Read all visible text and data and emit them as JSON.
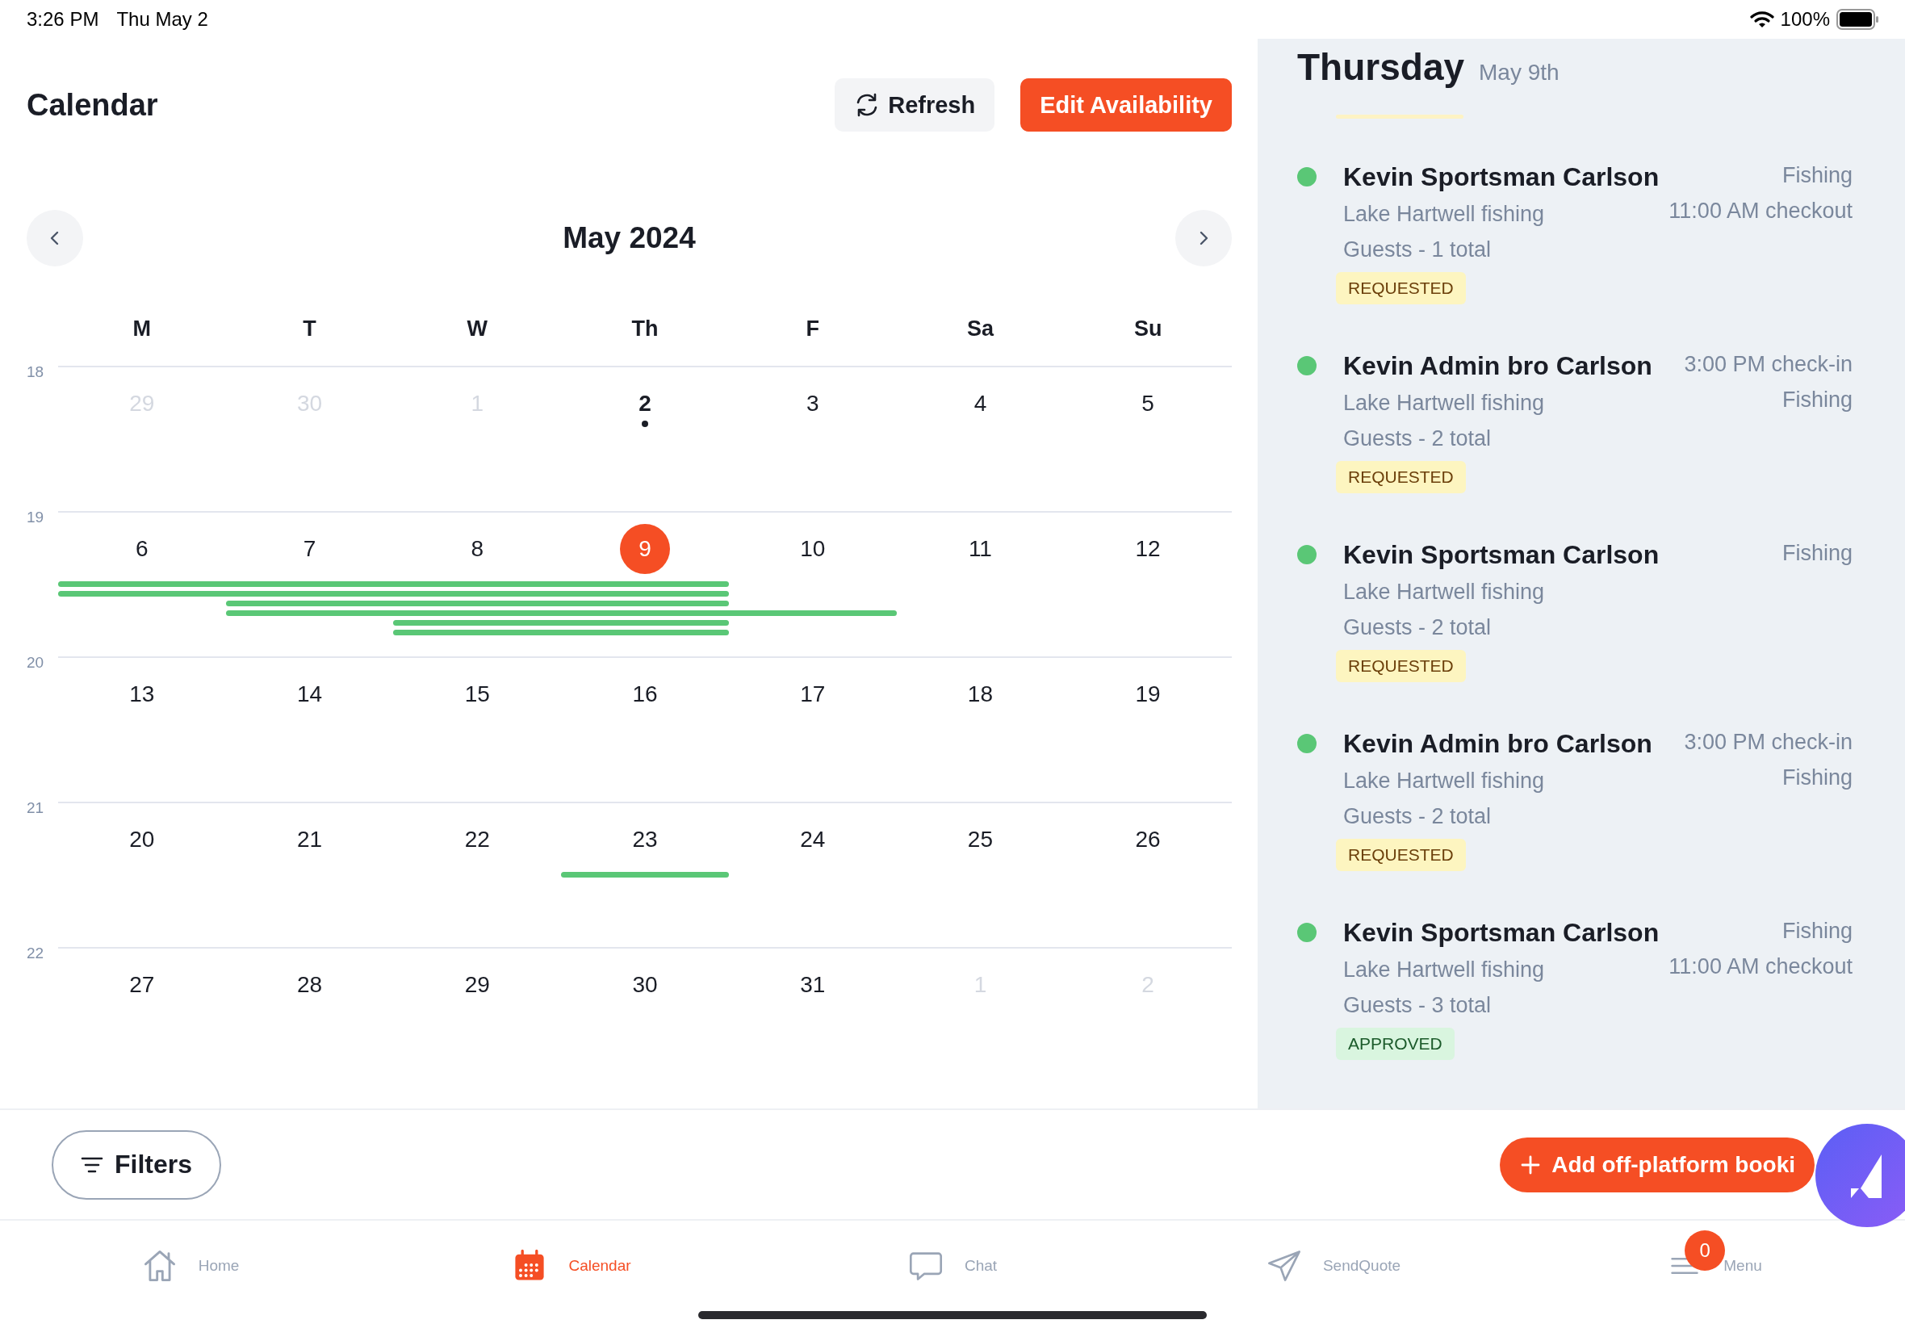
{
  "status_bar": {
    "time": "3:26 PM",
    "date": "Thu May 2",
    "battery": "100%"
  },
  "header": {
    "title": "Calendar",
    "buttons": [
      {
        "label": "Refresh",
        "kind": "secondary"
      },
      {
        "label": "Edit Availability",
        "kind": "primary"
      }
    ]
  },
  "calendar": {
    "month": "May 2024",
    "weekdays": [
      "M",
      "T",
      "W",
      "Th",
      "F",
      "Sa",
      "Su"
    ],
    "weeks": [
      {
        "number": "18",
        "days": [
          {
            "label": "29",
            "muted": true,
            "today": false,
            "selected": false
          },
          {
            "label": "30",
            "muted": true,
            "today": false,
            "selected": false
          },
          {
            "label": "1",
            "muted": true,
            "today": false,
            "selected": false
          },
          {
            "label": "2",
            "muted": false,
            "today": true,
            "selected": false
          },
          {
            "label": "3",
            "muted": false,
            "today": false,
            "selected": false
          },
          {
            "label": "4",
            "muted": false,
            "today": false,
            "selected": false
          },
          {
            "label": "5",
            "muted": false,
            "today": false,
            "selected": false
          }
        ]
      },
      {
        "number": "19",
        "days": [
          {
            "label": "6",
            "muted": false,
            "today": false,
            "selected": false
          },
          {
            "label": "7",
            "muted": false,
            "today": false,
            "selected": false
          },
          {
            "label": "8",
            "muted": false,
            "today": false,
            "selected": false
          },
          {
            "label": "9",
            "muted": false,
            "today": false,
            "selected": true
          },
          {
            "label": "10",
            "muted": false,
            "today": false,
            "selected": false
          },
          {
            "label": "11",
            "muted": false,
            "today": false,
            "selected": false
          },
          {
            "label": "12",
            "muted": false,
            "today": false,
            "selected": false
          }
        ],
        "bars": [
          {
            "days": [
              true,
              true,
              true,
              true,
              false,
              false,
              false
            ]
          },
          {
            "days": [
              true,
              true,
              true,
              true,
              false,
              false,
              false
            ]
          },
          {
            "days": [
              false,
              true,
              true,
              true,
              false,
              false,
              false
            ]
          },
          {
            "days": [
              false,
              true,
              true,
              true,
              true,
              false,
              false
            ]
          },
          {
            "days": [
              false,
              false,
              true,
              true,
              false,
              false,
              false
            ]
          },
          {
            "days": [
              false,
              false,
              true,
              true,
              false,
              false,
              false
            ]
          }
        ]
      },
      {
        "number": "20",
        "days": [
          {
            "label": "13",
            "muted": false,
            "today": false,
            "selected": false
          },
          {
            "label": "14",
            "muted": false,
            "today": false,
            "selected": false
          },
          {
            "label": "15",
            "muted": false,
            "today": false,
            "selected": false
          },
          {
            "label": "16",
            "muted": false,
            "today": false,
            "selected": false
          },
          {
            "label": "17",
            "muted": false,
            "today": false,
            "selected": false
          },
          {
            "label": "18",
            "muted": false,
            "today": false,
            "selected": false
          },
          {
            "label": "19",
            "muted": false,
            "today": false,
            "selected": false
          }
        ]
      },
      {
        "number": "21",
        "days": [
          {
            "label": "20",
            "muted": false,
            "today": false,
            "selected": false
          },
          {
            "label": "21",
            "muted": false,
            "today": false,
            "selected": false
          },
          {
            "label": "22",
            "muted": false,
            "today": false,
            "selected": false
          },
          {
            "label": "23",
            "muted": false,
            "today": false,
            "selected": false
          },
          {
            "label": "24",
            "muted": false,
            "today": false,
            "selected": false
          },
          {
            "label": "25",
            "muted": false,
            "today": false,
            "selected": false
          },
          {
            "label": "26",
            "muted": false,
            "today": false,
            "selected": false
          }
        ],
        "bars": [
          {
            "days": [
              false,
              false,
              false,
              true,
              false,
              false,
              false
            ]
          }
        ]
      },
      {
        "number": "22",
        "days": [
          {
            "label": "27",
            "muted": false,
            "today": false,
            "selected": false
          },
          {
            "label": "28",
            "muted": false,
            "today": false,
            "selected": false
          },
          {
            "label": "29",
            "muted": false,
            "today": false,
            "selected": false
          },
          {
            "label": "30",
            "muted": false,
            "today": false,
            "selected": false
          },
          {
            "label": "31",
            "muted": false,
            "today": false,
            "selected": false
          },
          {
            "label": "1",
            "muted": true,
            "today": false,
            "selected": false
          },
          {
            "label": "2",
            "muted": true,
            "today": false,
            "selected": false
          }
        ]
      }
    ]
  },
  "day_panel": {
    "weekday": "Thursday",
    "date": "May 9th",
    "bookings": [
      {
        "name": "Kevin Sportsman Carlson",
        "details": [
          "Lake Hartwell fishing",
          "Guests - 1 total"
        ],
        "right": [
          "Fishing",
          "11:00 AM checkout"
        ],
        "status": {
          "label": "REQUESTED",
          "kind": "requested"
        }
      },
      {
        "name": "Kevin Admin bro Carlson",
        "details": [
          "Lake Hartwell fishing",
          "Guests - 2 total"
        ],
        "right": [
          "3:00 PM check-in",
          "Fishing"
        ],
        "status": {
          "label": "REQUESTED",
          "kind": "requested"
        }
      },
      {
        "name": "Kevin Sportsman Carlson",
        "details": [
          "Lake Hartwell fishing",
          "Guests - 2 total"
        ],
        "right": [
          "Fishing"
        ],
        "status": {
          "label": "REQUESTED",
          "kind": "requested"
        }
      },
      {
        "name": "Kevin Admin bro Carlson",
        "details": [
          "Lake Hartwell fishing",
          "Guests - 2 total"
        ],
        "right": [
          "3:00 PM check-in",
          "Fishing"
        ],
        "status": {
          "label": "REQUESTED",
          "kind": "requested"
        }
      },
      {
        "name": "Kevin Sportsman Carlson",
        "details": [
          "Lake Hartwell fishing",
          "Guests - 3 total"
        ],
        "right": [
          "Fishing",
          "11:00 AM checkout"
        ],
        "status": {
          "label": "APPROVED",
          "kind": "approved"
        }
      }
    ]
  },
  "actions": {
    "filters": "Filters",
    "add": "Add off-platform booki"
  },
  "tab_bar": [
    {
      "label": "Home",
      "selected": false
    },
    {
      "label": "Calendar",
      "selected": true
    },
    {
      "label": "Chat",
      "selected": false
    },
    {
      "label": "SendQuote",
      "selected": false
    },
    {
      "label": "Menu",
      "selected": false,
      "badge": "0"
    }
  ]
}
